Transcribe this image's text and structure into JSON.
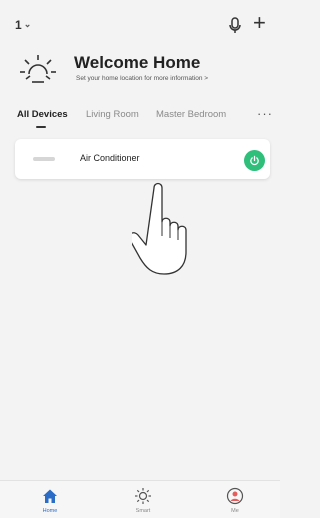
{
  "header": {
    "home_selector": "1",
    "icons": [
      "chevron-down-icon",
      "microphone-icon",
      "plus-icon"
    ]
  },
  "welcome": {
    "title": "Welcome Home",
    "subtitle": "Set your home location for more information >",
    "icon": "sun-icon"
  },
  "tabs": [
    {
      "label": "All Devices",
      "active": true
    },
    {
      "label": "Living Room",
      "active": false
    },
    {
      "label": "Master Bedroom",
      "active": false
    }
  ],
  "more_label": "···",
  "devices": [
    {
      "name": "Air Conditioner",
      "icon": "air-conditioner-icon",
      "power_color": "#2fbf7a"
    }
  ],
  "bottom_nav": [
    {
      "label": "Home",
      "icon": "home-icon",
      "active": true
    },
    {
      "label": "Smart",
      "icon": "sun-outline-icon",
      "active": false
    },
    {
      "label": "Me",
      "icon": "profile-icon",
      "active": false
    }
  ],
  "colors": {
    "accent": "#2b6cc7",
    "power_on": "#2fbf7a",
    "background": "#f3f3f3"
  }
}
